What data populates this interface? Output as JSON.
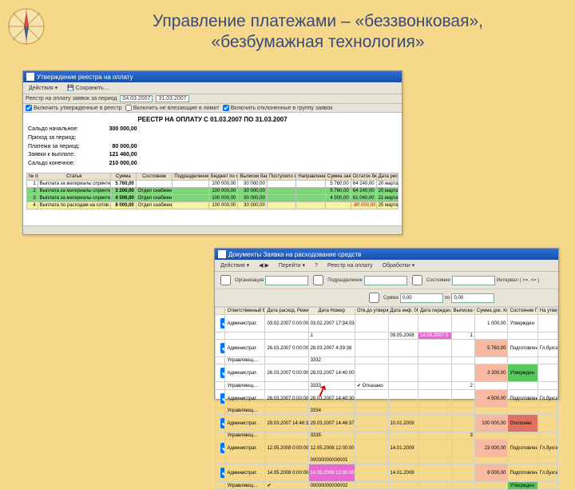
{
  "title_line1": "Управление платежами – «беззвонковая»,",
  "title_line2": "«безбумажная технология»",
  "panel1": {
    "caption": "Утверждение реестра на оплату",
    "actions_label": "Действия ▾",
    "save_label": "💾  Сохранить…",
    "filter_label": "Реестр на оплату заявок за период",
    "date_from": "04.03.2007",
    "date_to": "31.03.2007",
    "chk1": "Включить утвержденные в реестр",
    "chk2": "Включить не влезающие в лимит",
    "chk3": "Включить отклоненные в группу заявок",
    "report_title": "РЕЕСТР НА ОПЛАТУ С 01.03.2007 ПО 31.03.2007",
    "summary": [
      {
        "k": "Сальдо начальное:",
        "v": "300 000,00"
      },
      {
        "k": "Приход за период:",
        "v": ""
      },
      {
        "k": "Платежи за период:",
        "v": "80 000,00"
      },
      {
        "k": "Заявки к выплате:",
        "v": "121 460,00"
      },
      {
        "k": "Сальдо конечное:",
        "v": "210 000,00"
      }
    ],
    "cols": [
      "№ пп",
      "Статья",
      "Сумма",
      "Состояние",
      "Подразделение остатки по центр. ответ. данные из смет",
      "Бюджет по статье на месяц",
      "Выписки банка: отгружено",
      "Поступило в банк: из проекта перечислений",
      "Направленные на оплату в банк",
      "Сумма заявок по данной статье",
      "Остаток бюджета с учетом заявок",
      "Дата регистрации"
    ],
    "rows": [
      {
        "n": "1",
        "st": "Выплата за материалы спринтер(о)",
        "sum": "5 760,00",
        "state": "",
        "dep": "",
        "b": "100 000,00",
        "v1": "30 000,00",
        "v2": "",
        "v3": "",
        "s": "5 760,00",
        "ost": "64 240,00",
        "d": "20 марта"
      },
      {
        "n": "2",
        "st": "Выплата за материалы спринтер(о)",
        "sum": "3 200,00",
        "state": "Отдел снабжения",
        "dep": "",
        "b": "100 000,00",
        "v1": "30 000,00",
        "v2": "",
        "v3": "",
        "s": "5 760,00",
        "ost": "64 240,00",
        "d": "20 марта",
        "cls": "r-green"
      },
      {
        "n": "3",
        "st": "Выплата за материалы спринтер(о)",
        "sum": "4 500,00",
        "state": "Отдел снабжения",
        "dep": "",
        "b": "100 000,00",
        "v1": "30 000,00",
        "v2": "",
        "v3": "",
        "s": "4 500,00",
        "ost": "61 040,00",
        "d": "21 марта",
        "cls": "r-green"
      },
      {
        "n": "4",
        "st": "Выплата по расходам на сотов. связь и др. связь",
        "sum": "8 000,00",
        "state": "Отдел снабжения",
        "dep": "",
        "b": "100 000,00",
        "v1": "30 000,00",
        "v2": "",
        "v3": "",
        "s": "",
        "ost": "-80 000,00",
        "d": "25 марта",
        "cls": "r-yellow",
        "neg": true
      }
    ]
  },
  "panel2": {
    "caption": "Документы Заявка на расходование средств",
    "tb": {
      "act": "Действия ▾",
      "nav": "◀ ▶",
      "goto": "Перейти ▾",
      "help": "?",
      "reestr": "Реестр на оплату",
      "proc": "Обработки ▾"
    },
    "filters": {
      "org": "Организация",
      "org_v": "",
      "dep": "Подразделение",
      "dep_v": "",
      "state": "Состояние",
      "state_v": "",
      "sum": "Сумма",
      "sum_v": "0,00",
      "int": "Интервал ( >=, <= )",
      "int_v": "▾",
      "to": "по",
      "to_v": "0,00"
    },
    "cols": [
      "",
      "Ответственный База данных",
      "Дата расход. Режим банк/касса",
      "Дата Номер",
      "Отв.до утвержд. Отказано бан.",
      "Дата инф. 069",
      "Дата передач. Дата оплаты",
      "Выписка б. Номер п/п.",
      "Сумма док. Комментарий",
      "Состояние Передано в",
      "На утверждении"
    ],
    "rows": [
      {
        "chk": true,
        "c1": "Администрат.",
        "c2": "03.02.2007 0:00:00",
        "c3": "03.02.2007 17:34:03",
        "c4": "",
        "c5": "",
        "c6": "",
        "c7": "",
        "c8": "1 000,00",
        "c9": "Утвержден",
        "c10": ""
      },
      {
        "chk": false,
        "c1": "",
        "c2": "",
        "c3": "1",
        "c4": "",
        "c5": "09.05.2008",
        "c6": "14.03.2007 0",
        "c6cls": "cell-mag",
        "c7": "1",
        "c8": "",
        "c9": "",
        "c10": ""
      },
      {
        "chk": true,
        "c1": "Администрат.",
        "c2": "26.03.2007 0:00:00",
        "c3": "28.03.2007 4:39:38",
        "c4": "",
        "c5": "",
        "c6": "",
        "c7": "",
        "c8": "5 760,00",
        "c8cls": "cell-sal",
        "c9": "Подготовлен",
        "c10": "Гл.бухгалт."
      },
      {
        "chk": false,
        "c1": "Управляющ…",
        "c2": "",
        "c3": "3332",
        "c4": "",
        "c5": "",
        "c6": "",
        "c7": "",
        "c8": "",
        "c9": "",
        "c10": ""
      },
      {
        "chk": true,
        "c1": "Администрат.",
        "c2": "26.03.2007 0:00:00",
        "c3": "28.03.2007 14:40:00",
        "c4": "",
        "c5": "",
        "c6": "",
        "c7": "",
        "c8": "3 200,00",
        "c8cls": "cell-sal",
        "c9": "Утвержден",
        "c9cls": "cell-grn",
        "c10": ""
      },
      {
        "chk": false,
        "c1": "Управляющ…",
        "c2": "",
        "c3": "3333",
        "c4": "✔ Отказано",
        "c4cls": "cell-dotted",
        "c5": "",
        "c6": "",
        "c7": "2",
        "c8": "",
        "c9": "",
        "c10": ""
      },
      {
        "chk": true,
        "c1": "Администрат.",
        "c2": "26.03.2007 0:00:00",
        "c3": "28.03.2007 14:40:30",
        "c4": "",
        "c5": "",
        "c6": "",
        "c7": "",
        "c8": "4 500,00",
        "c8cls": "cell-sal",
        "c9": "Подготовлен",
        "c10": "Гл.бухгалт."
      },
      {
        "chk": false,
        "c1": "Управляющ…",
        "c2": "",
        "c3": "3334",
        "c4": "",
        "c5": "",
        "c6": "",
        "c7": "",
        "c8": "",
        "c9": "",
        "c10": ""
      },
      {
        "chk": true,
        "c1": "Администрат.",
        "c2": "29.03.2007 14:46:37",
        "c3": "29.03.2007 14:46:37",
        "c4": "",
        "c5": "10.01.2009",
        "c6": "",
        "c7": "",
        "c8": "100 000,00",
        "c8cls": "cell-sal",
        "c9": "Отклонен",
        "c9cls": "cell-red",
        "c10": ""
      },
      {
        "chk": false,
        "c1": "Управляющ…",
        "c2": "",
        "c3": "3335",
        "c4": "",
        "c5": "",
        "c6": "",
        "c7": "3",
        "c8": "",
        "c9": "",
        "c10": ""
      },
      {
        "chk": true,
        "c1": "Администрат.",
        "c2": "12.05.2008 0:00:00",
        "c3": "12.05.2008 12:00:00",
        "c4": "",
        "c5": "14.01.2009",
        "c6": "",
        "c7": "",
        "c8": "23 000,00",
        "c8cls": "cell-sal",
        "c9": "Подготовлен",
        "c10": "Гл.бухгалт."
      },
      {
        "chk": false,
        "c1": "",
        "c2": "",
        "c3": "00000000000001",
        "c4": "",
        "c5": "",
        "c6": "",
        "c7": "",
        "c8": "",
        "c9": "",
        "c10": ""
      },
      {
        "chk": true,
        "c1": "Администрат.",
        "c2": "14.05.2008 0:00:00",
        "c3": "14.05.2008 12:00:00 ",
        "c3cls": "cell-mag",
        "c4": "",
        "c5": "14.01.2009",
        "c6": "",
        "c7": "",
        "c8": "8 000,00",
        "c8cls": "cell-sal",
        "c9": "Подготовлен",
        "c10": "Гл.бухгалт."
      },
      {
        "chk": false,
        "c1": "Управляющ…",
        "c2": "✔",
        "c3": "00000000000002",
        "c4": "",
        "c5": "",
        "c6": "",
        "c7": "",
        "c8": "",
        "c9": "Утвержден",
        "c9cls": "cell-grn",
        "c10": ""
      }
    ]
  }
}
